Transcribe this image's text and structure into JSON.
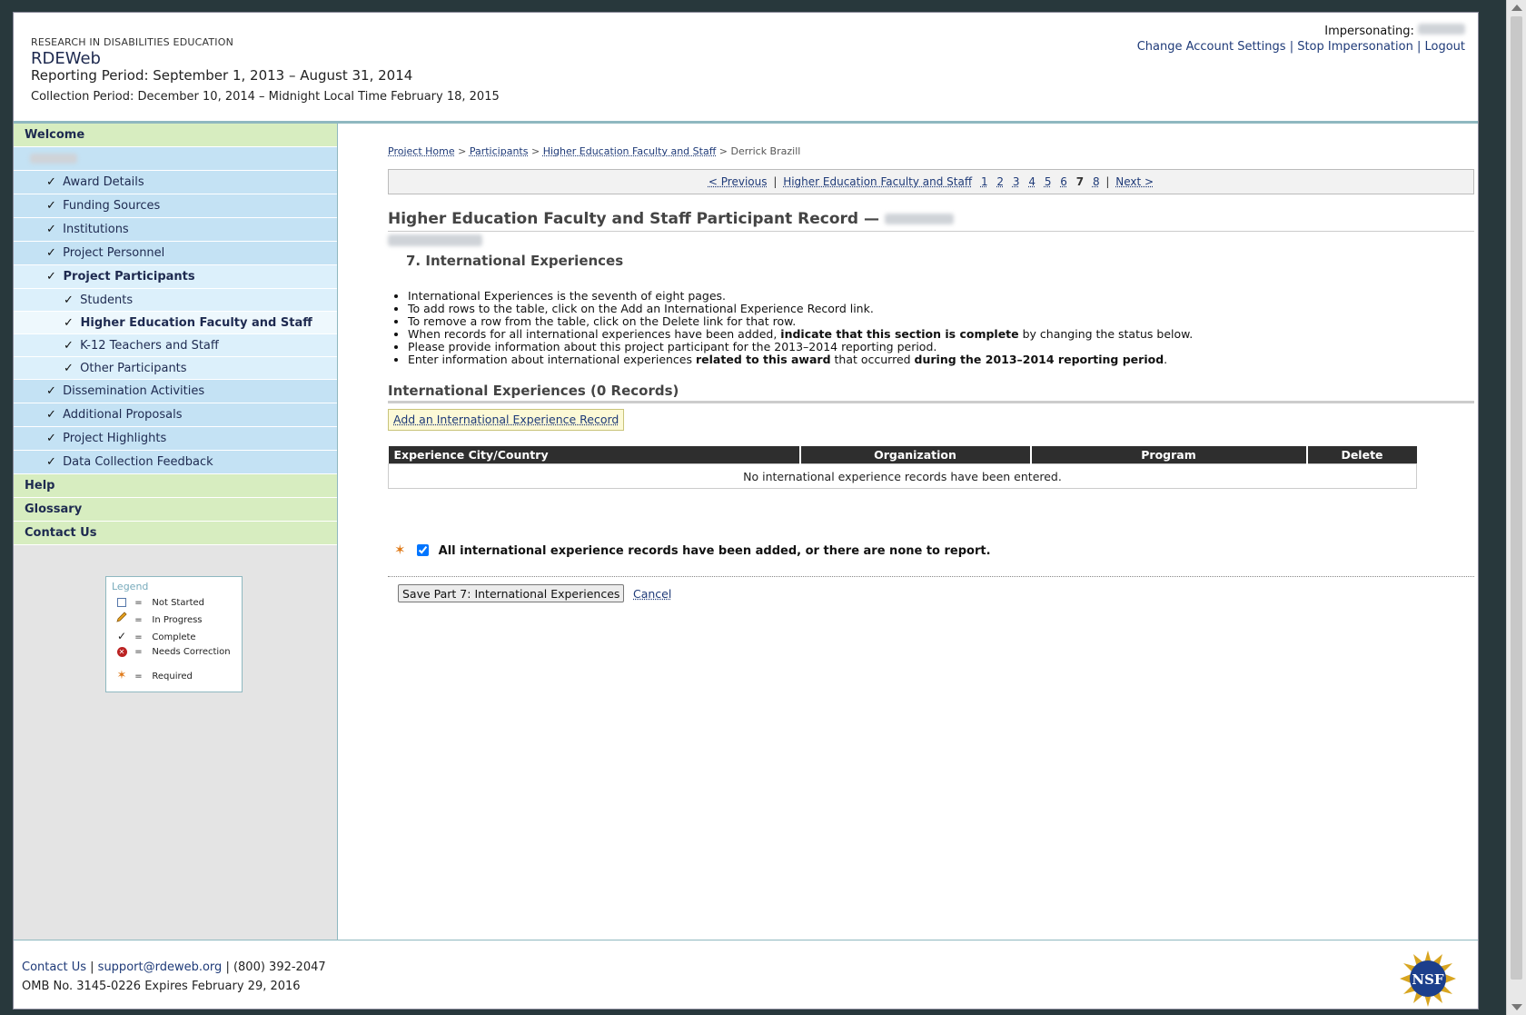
{
  "header": {
    "org_name": "RESEARCH IN DISABILITIES EDUCATION",
    "app_name": "RDEWeb",
    "reporting_period": "Reporting Period: September 1, 2013 – August 31, 2014",
    "collection_period": "Collection Period: December 10, 2014 – Midnight Local Time February 18, 2015",
    "impersonating_label": "Impersonating:",
    "links": {
      "change_account": "Change Account Settings",
      "stop_impersonation": "Stop Impersonation",
      "logout": "Logout"
    }
  },
  "sidebar": {
    "welcome": "Welcome",
    "items": {
      "award_details": "Award Details",
      "funding_sources": "Funding Sources",
      "institutions": "Institutions",
      "project_personnel": "Project Personnel",
      "project_participants": "Project Participants",
      "students": "Students",
      "higher_ed": "Higher Education Faculty and Staff",
      "k12": "K-12 Teachers and Staff",
      "other_participants": "Other Participants",
      "dissemination": "Dissemination Activities",
      "additional_proposals": "Additional Proposals",
      "project_highlights": "Project Highlights",
      "data_collection_feedback": "Data Collection Feedback"
    },
    "help": "Help",
    "glossary": "Glossary",
    "contact_us": "Contact Us",
    "check_glyph": "✓",
    "legend": {
      "title": "Legend",
      "eq": "=",
      "not_started": "Not Started",
      "in_progress": "In Progress",
      "complete": "Complete",
      "needs_correction": "Needs Correction",
      "required": "Required"
    }
  },
  "breadcrumb": {
    "project_home": "Project Home",
    "participants": "Participants",
    "higher_ed": "Higher Education Faculty and Staff",
    "current": "Derrick Brazill",
    "sep": ">"
  },
  "pager": {
    "previous": "< Previous",
    "section": "Higher Education Faculty and Staff",
    "pages": [
      "1",
      "2",
      "3",
      "4",
      "5",
      "6",
      "7",
      "8"
    ],
    "current_page": "7",
    "next": "Next >",
    "sep": "|"
  },
  "record": {
    "title": "Higher Education Faculty and Staff Participant Record —",
    "section_title": "7. International Experiences"
  },
  "instructions": {
    "i1": "International Experiences is the seventh of eight pages.",
    "i2": "To add rows to the table, click on the Add an International Experience Record link.",
    "i3": "To remove a row from the table, click on the Delete link for that row.",
    "i4a": "When records for all international experiences have been added, ",
    "i4b": "indicate that this section is complete",
    "i4c": " by changing the status below.",
    "i5": "Please provide information about this project participant for the 2013–2014 reporting period.",
    "i6a": "Enter information about international experiences ",
    "i6b": "related to this award",
    "i6c": " that occurred ",
    "i6d": "during the 2013–2014 reporting period",
    "i6e": "."
  },
  "table": {
    "heading": "International Experiences (0 Records)",
    "add_link": "Add an International Experience Record",
    "columns": [
      "Experience City/Country",
      "Organization",
      "Program",
      "Delete"
    ],
    "empty_message": "No international experience records have been entered."
  },
  "completion": {
    "star": "✶",
    "label": "All international experience records have been added, or there are none to report.",
    "checked": true
  },
  "actions": {
    "save": "Save Part 7: International Experiences",
    "cancel": "Cancel"
  },
  "footer": {
    "contact": "Contact Us",
    "email": "support@rdeweb.org",
    "phone": "(800) 392-2047",
    "sep": "|",
    "omb": "OMB No. 3145-0226 Expires February 29, 2016",
    "logo_text": "NSF"
  },
  "colors": {
    "nav_top": "#d7edc0",
    "nav_level1": "#c4e2f4",
    "nav_level2": "#dcf0fb",
    "table_header": "#2e2e2e",
    "required_star": "#e07b1a"
  }
}
